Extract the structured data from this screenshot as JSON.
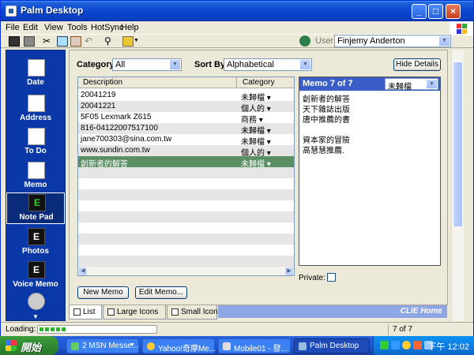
{
  "window": {
    "title": "Palm Desktop"
  },
  "menu": [
    "File",
    "Edit",
    "View",
    "Tools",
    "HotSync",
    "Help"
  ],
  "toolbar": {
    "user_label": "User:",
    "user_value": "Finjemy Anderton"
  },
  "nav": [
    {
      "label": "Date",
      "icon": "calendar-icon"
    },
    {
      "label": "Address",
      "icon": "address-card-icon"
    },
    {
      "label": "To Do",
      "icon": "checklist-icon"
    },
    {
      "label": "Memo",
      "icon": "memo-pad-icon"
    },
    {
      "label": "Note Pad",
      "icon": "e-app-icon"
    },
    {
      "label": "Photos",
      "icon": "e-app-icon"
    },
    {
      "label": "Voice Memo",
      "icon": "e-app-icon"
    }
  ],
  "filter": {
    "category_label": "Category:",
    "category_value": "All",
    "sort_label": "Sort By:",
    "sort_value": "Alphabetical",
    "hide_details": "Hide Details"
  },
  "list": {
    "col_description": "Description",
    "col_category": "Category",
    "rows": [
      {
        "description": "20041219",
        "category": "未歸檔 ▾"
      },
      {
        "description": "20041221",
        "category": "個人的 ▾"
      },
      {
        "description": "5F05 Lexmark Z615",
        "category": "商務 ▾"
      },
      {
        "description": "816-04122007517100",
        "category": "未歸檔 ▾"
      },
      {
        "description": "jane700303@sina.com.tw",
        "category": "未歸檔 ▾"
      },
      {
        "description": "www.sundin.com.tw",
        "category": "個人的 ▾"
      },
      {
        "description": "創新者的解答",
        "category": "未歸檔 ▾"
      }
    ],
    "selected_index": 6
  },
  "memo": {
    "title": "Memo 7 of 7",
    "category": "未歸檔",
    "lines": [
      "創新者的解答",
      "天下雜誌出版",
      "唐中推薦的書",
      "",
      "資本家的冒險",
      "高慧慧推薦."
    ],
    "private_label": "Private:"
  },
  "buttons": {
    "new_memo": "New Memo",
    "edit_memo": "Edit Memo..."
  },
  "tabs": [
    "List",
    "Large Icons",
    "Small Icons"
  ],
  "brand": "CLIE Home",
  "status": {
    "text": "Loading:",
    "progress": 0.22,
    "count": "7 of 7"
  },
  "taskbar": {
    "start": "開始",
    "tasks": [
      "2 MSN Messe...",
      "Yahoo!奇摩Me...",
      "Mobile01 - 發...",
      "Palm Desktop"
    ],
    "clock": "下午 12:02"
  }
}
